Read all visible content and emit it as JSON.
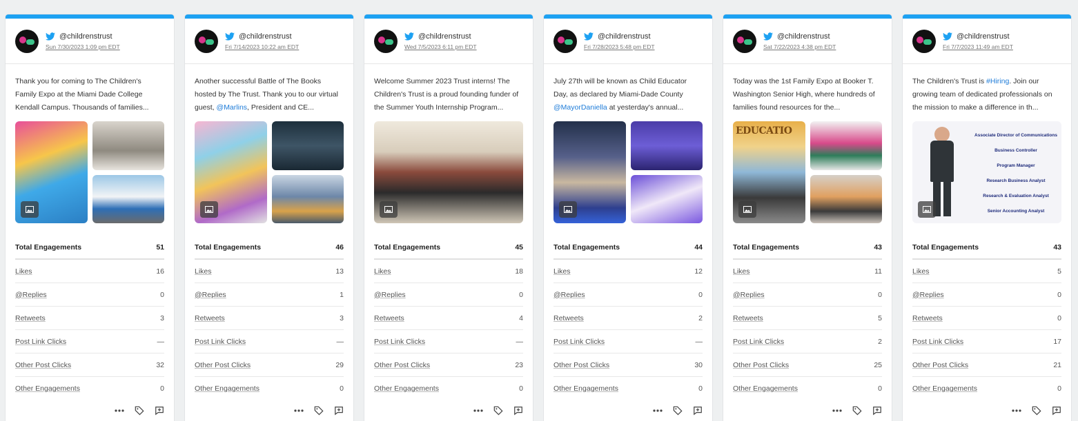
{
  "posts": [
    {
      "handle": "@childrenstrust",
      "date": "Sun 7/30/2023 1:09 pm EDT",
      "text": "Thank you for coming to The Children's Family Expo at the Miami Dade College Kendall Campus. Thousands of families...",
      "stats": [
        {
          "label": "Total Engagements",
          "value": "51"
        },
        {
          "label": "Likes",
          "value": "16"
        },
        {
          "label": "@Replies",
          "value": "0"
        },
        {
          "label": "Retweets",
          "value": "3"
        },
        {
          "label": "Post Link Clicks",
          "value": "—"
        },
        {
          "label": "Other Post Clicks",
          "value": "32"
        },
        {
          "label": "Other Engagements",
          "value": "0"
        }
      ]
    },
    {
      "handle": "@childrenstrust",
      "date": "Fri 7/14/2023 10:22 am EDT",
      "text_parts": [
        "Another successful Battle of The Books hosted by The Trust. Thank you to our virtual guest, ",
        "@Marlins",
        ", President and CE..."
      ],
      "stats": [
        {
          "label": "Total Engagements",
          "value": "46"
        },
        {
          "label": "Likes",
          "value": "13"
        },
        {
          "label": "@Replies",
          "value": "1"
        },
        {
          "label": "Retweets",
          "value": "3"
        },
        {
          "label": "Post Link Clicks",
          "value": "—"
        },
        {
          "label": "Other Post Clicks",
          "value": "29"
        },
        {
          "label": "Other Engagements",
          "value": "0"
        }
      ]
    },
    {
      "handle": "@childrenstrust",
      "date": "Wed 7/5/2023 6:11 pm EDT",
      "text": "Welcome Summer 2023 Trust interns! The Children's Trust is a proud founding funder of the Summer Youth Internship Program...",
      "stats": [
        {
          "label": "Total Engagements",
          "value": "45"
        },
        {
          "label": "Likes",
          "value": "18"
        },
        {
          "label": "@Replies",
          "value": "0"
        },
        {
          "label": "Retweets",
          "value": "4"
        },
        {
          "label": "Post Link Clicks",
          "value": "—"
        },
        {
          "label": "Other Post Clicks",
          "value": "23"
        },
        {
          "label": "Other Engagements",
          "value": "0"
        }
      ]
    },
    {
      "handle": "@childrenstrust",
      "date": "Fri 7/28/2023 5:48 pm EDT",
      "text_parts": [
        "July 27th will be known as Child Educator Day, as declared by Miami-Dade County ",
        "@MayorDaniella",
        " at yesterday's annual..."
      ],
      "stats": [
        {
          "label": "Total Engagements",
          "value": "44"
        },
        {
          "label": "Likes",
          "value": "12"
        },
        {
          "label": "@Replies",
          "value": "0"
        },
        {
          "label": "Retweets",
          "value": "2"
        },
        {
          "label": "Post Link Clicks",
          "value": "—"
        },
        {
          "label": "Other Post Clicks",
          "value": "30"
        },
        {
          "label": "Other Engagements",
          "value": "0"
        }
      ]
    },
    {
      "handle": "@childrenstrust",
      "date": "Sat 7/22/2023 4:38 pm EDT",
      "text": "Today was the 1st Family Expo at Booker T. Washington Senior High, where hundreds of families found resources for the...",
      "image_text": "EDUCATIO",
      "stats": [
        {
          "label": "Total Engagements",
          "value": "43"
        },
        {
          "label": "Likes",
          "value": "11"
        },
        {
          "label": "@Replies",
          "value": "0"
        },
        {
          "label": "Retweets",
          "value": "5"
        },
        {
          "label": "Post Link Clicks",
          "value": "2"
        },
        {
          "label": "Other Post Clicks",
          "value": "25"
        },
        {
          "label": "Other Engagements",
          "value": "0"
        }
      ]
    },
    {
      "handle": "@childrenstrust",
      "date": "Fri 7/7/2023 11:49 am EDT",
      "text_parts": [
        "The Children's Trust is ",
        "#Hiring",
        ". Join our growing team of dedicated professionals on the mission to make a difference in th..."
      ],
      "poster_roles": [
        "Associate Director of Communications",
        "Business Controller",
        "Program Manager",
        "Research Business Analyst",
        "Research & Evaluation Analyst",
        "Senior Accounting Analyst"
      ],
      "stats": [
        {
          "label": "Total Engagements",
          "value": "43"
        },
        {
          "label": "Likes",
          "value": "5"
        },
        {
          "label": "@Replies",
          "value": "0"
        },
        {
          "label": "Retweets",
          "value": "0"
        },
        {
          "label": "Post Link Clicks",
          "value": "17"
        },
        {
          "label": "Other Post Clicks",
          "value": "21"
        },
        {
          "label": "Other Engagements",
          "value": "0"
        }
      ]
    }
  ],
  "colors": {
    "twitter_blue": "#1da1f2",
    "link_blue": "#1d7bd8"
  },
  "icons": [
    "twitter-bird-icon",
    "image-icon",
    "more-options-icon",
    "tag-icon",
    "add-note-icon"
  ]
}
